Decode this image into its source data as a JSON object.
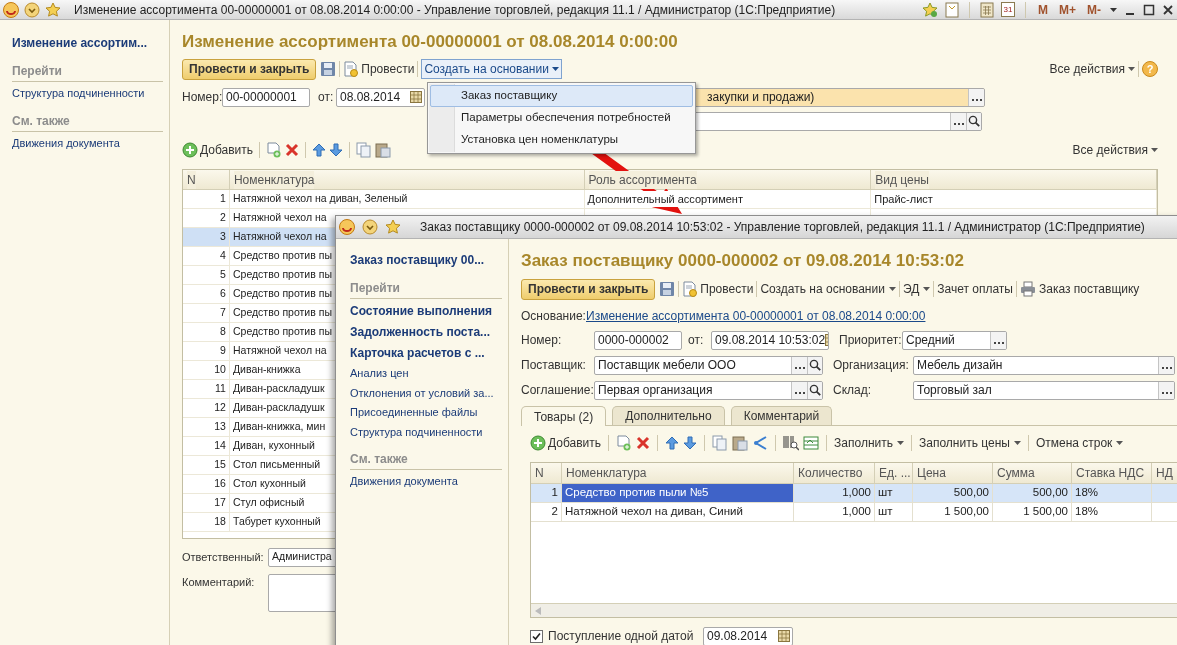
{
  "main_window": {
    "title": "Изменение ассортимента 00-00000001 от 08.08.2014 0:00:00 - Управление торговлей, редакция 11.1 / Администратор  (1С:Предприятие)",
    "calendar_day": "31",
    "memory_buttons": [
      "M",
      "M+",
      "M-"
    ],
    "sidebar": {
      "current": "Изменение ассортим...",
      "sections": [
        {
          "heading": "Перейти",
          "links": [
            {
              "label": "Структура подчиненности",
              "bold": false
            }
          ]
        },
        {
          "heading": "См. также",
          "links": [
            {
              "label": "Движения документа",
              "bold": false
            }
          ]
        }
      ]
    },
    "heading": "Изменение ассортимента 00-00000001 от 08.08.2014 0:00:00",
    "toolbar": {
      "post_and_close": "Провести и закрыть",
      "post": "Провести",
      "create_based_on": "Создать на основании",
      "all_actions": "Все действия",
      "help": "?"
    },
    "number": {
      "label": "Номер:",
      "value": "00-00000001"
    },
    "date": {
      "label": "от:",
      "value": "08.08.2014"
    },
    "field_3": {
      "value": "закупки и продажи)"
    },
    "table_toolbar": {
      "add": "Добавить",
      "all_actions": "Все действия"
    },
    "table": {
      "columns": [
        "N",
        "Номенклатура",
        "Роль ассортимента",
        "Вид цены"
      ],
      "rows": [
        {
          "n": "1",
          "item": "Натяжной чехол на диван, Зеленый",
          "role": "Дополнительный ассортимент",
          "price_type": "Прайс-лист",
          "selected": false
        },
        {
          "n": "2",
          "item": "Натяжной чехол на",
          "selected": false
        },
        {
          "n": "3",
          "item": "Натяжной чехол на",
          "selected": true
        },
        {
          "n": "4",
          "item": "Средство против пы",
          "selected": false
        },
        {
          "n": "5",
          "item": "Средство против пы",
          "selected": false
        },
        {
          "n": "6",
          "item": "Средство против пы",
          "selected": false
        },
        {
          "n": "7",
          "item": "Средство против пы",
          "selected": false
        },
        {
          "n": "8",
          "item": "Средство против пы",
          "selected": false
        },
        {
          "n": "9",
          "item": "Натяжной чехол на",
          "selected": false
        },
        {
          "n": "10",
          "item": "Диван-книжка",
          "selected": false
        },
        {
          "n": "11",
          "item": "Диван-раскладушк",
          "selected": false
        },
        {
          "n": "12",
          "item": "Диван-раскладушк",
          "selected": false
        },
        {
          "n": "13",
          "item": "Диван-книжка, мин",
          "selected": false
        },
        {
          "n": "14",
          "item": "Диван, кухонный",
          "selected": false
        },
        {
          "n": "15",
          "item": "Стол письменный",
          "selected": false
        },
        {
          "n": "16",
          "item": "Стол кухонный",
          "selected": false
        },
        {
          "n": "17",
          "item": "Стул офисный",
          "selected": false
        },
        {
          "n": "18",
          "item": "Табурет кухонный",
          "selected": false
        }
      ]
    },
    "responsible": {
      "label": "Ответственный:",
      "value": "Администра"
    },
    "comment": {
      "label": "Комментарий:"
    }
  },
  "menu": {
    "items": [
      {
        "label": "Заказ поставщику",
        "selected": true
      },
      {
        "label": "Параметры обеспечения потребностей",
        "selected": false
      },
      {
        "label": "Установка цен номенклатуры",
        "selected": false
      }
    ]
  },
  "order_window": {
    "title": "Заказ поставщику 0000-000002 от 09.08.2014 10:53:02 - Управление торговлей, редакция 11.1 / Администратор  (1С:Предприятие)",
    "sidebar": {
      "current": "Заказ поставщику 00...",
      "sections": [
        {
          "heading": "Перейти",
          "links": [
            {
              "label": "Состояние выполнения",
              "bold": true
            },
            {
              "label": "Задолженность поста...",
              "bold": true
            },
            {
              "label": "Карточка расчетов с ...",
              "bold": true
            },
            {
              "label": "Анализ цен",
              "bold": false
            },
            {
              "label": "Отклонения от условий за...",
              "bold": false
            },
            {
              "label": "Присоединенные файлы",
              "bold": false
            },
            {
              "label": "Структура подчиненности",
              "bold": false
            }
          ]
        },
        {
          "heading": "См. также",
          "links": [
            {
              "label": "Движения документа",
              "bold": false
            }
          ]
        }
      ]
    },
    "heading": "Заказ поставщику 0000-000002 от 09.08.2014 10:53:02",
    "toolbar": [
      {
        "kind": "primary",
        "label": "Провести и закрыть"
      },
      {
        "kind": "save"
      },
      {
        "kind": "post",
        "label": "Провести"
      },
      {
        "kind": "menu",
        "label": "Создать на основании"
      },
      {
        "kind": "menu",
        "label": "ЭД"
      },
      {
        "kind": "plain",
        "label": "Зачет оплаты"
      },
      {
        "kind": "print",
        "label": "Заказ поставщику"
      }
    ],
    "basis": {
      "label": "Основание:",
      "link": "Изменение ассортимента 00-00000001 от 08.08.2014 0:00:00"
    },
    "number": {
      "label": "Номер:",
      "value": "0000-000002"
    },
    "date": {
      "label": "от:",
      "value": "09.08.2014 10:53:02"
    },
    "priority": {
      "label": "Приоритет:",
      "value": "Средний"
    },
    "supplier": {
      "label": "Поставщик:",
      "value": "Поставщик мебели ООО"
    },
    "organization": {
      "label": "Организация:",
      "value": "Мебель дизайн"
    },
    "agreement": {
      "label": "Соглашение:",
      "value": "Первая организация"
    },
    "warehouse": {
      "label": "Склад:",
      "value": "Торговый зал"
    },
    "tabs": [
      {
        "label": "Товары (2)",
        "selected": true
      },
      {
        "label": "Дополнительно",
        "selected": false
      },
      {
        "label": "Комментарий",
        "selected": false
      }
    ],
    "table_toolbar": {
      "add": "Добавить",
      "menus": [
        "Заполнить",
        "Заполнить цены",
        "Отмена строк"
      ]
    },
    "table": {
      "columns": [
        "N",
        "Номенклатура",
        "Количество",
        "Ед. ...",
        "Цена",
        "Сумма",
        "Ставка НДС",
        "НД"
      ],
      "rows": [
        {
          "n": "1",
          "item": "Средство против пыли №5",
          "qty": "1,000",
          "unit": "шт",
          "price": "500,00",
          "sum": "500,00",
          "vat_rate": "18%",
          "selected": true
        },
        {
          "n": "2",
          "item": "Натяжной чехол на диван, Синий",
          "qty": "1,000",
          "unit": "шт",
          "price": "1 500,00",
          "sum": "1 500,00",
          "vat_rate": "18%",
          "selected": false
        }
      ]
    },
    "single_date": {
      "label": "Поступление одной датой",
      "checked": true,
      "date": "09.08.2014"
    }
  }
}
